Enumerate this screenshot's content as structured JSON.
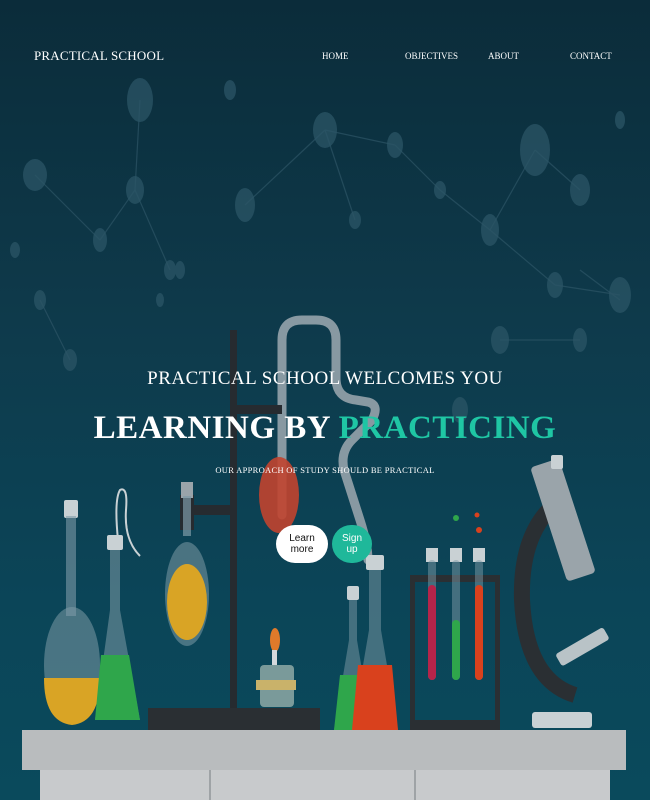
{
  "nav": {
    "brand": "PRACTICAL SCHOOL",
    "links": [
      "HOME",
      "OBJECTIVES",
      "ABOUT",
      "CONTACT"
    ]
  },
  "hero": {
    "welcome": "PRACTICAL SCHOOL WELCOMES YOU",
    "headline_main": "LEARNING BY ",
    "headline_accent": "PRACTICING",
    "subline": "OUR APPROACH OF STUDY SHOULD BE PRACTICAL",
    "learn_label": "Learn more",
    "signup_label": "Sign up"
  },
  "colors": {
    "accent": "#1fc6a4",
    "background": "#0b3a4a"
  },
  "icons": [
    "molecule-network",
    "lab-flask",
    "test-tube-rack",
    "microscope",
    "burner"
  ]
}
